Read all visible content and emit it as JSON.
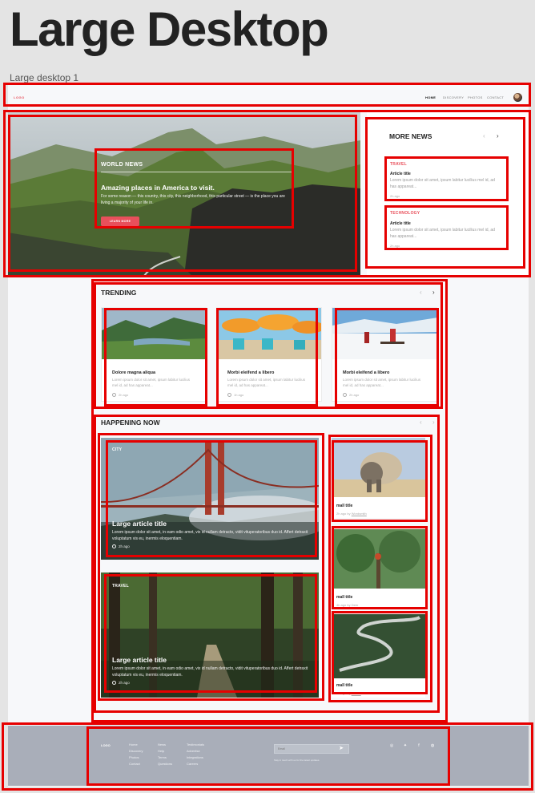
{
  "page": {
    "heading": "Large Desktop",
    "frame_label": "Large desktop 1"
  },
  "colors": {
    "accent": "#e8505b",
    "annotation_box": "#e60000",
    "footer_bg": "#a9aeb9",
    "canvas": "#f7f8fa"
  },
  "nav": {
    "logo": "LOGO",
    "links": [
      "HOME",
      "DISCOVERY",
      "PHOTOS",
      "CONTACT"
    ],
    "active": "HOME",
    "avatar_icon": "user-avatar"
  },
  "hero": {
    "eyebrow": "WORLD NEWS",
    "title": "Amazing places in America to visit.",
    "text": "For some reason — this country, this city, this neighborhood, this particular street — is the place you are living a majority of your life in.",
    "button": "LEARN MORE"
  },
  "more_news": {
    "title": "MORE NEWS",
    "prev_icon": "chevron-left-icon",
    "next_icon": "chevron-right-icon",
    "items": [
      {
        "category": "TRAVEL",
        "title": "Article title",
        "text": "Lorem ipsum dolor sit amet, ipsum labitur lucilius mel id, ad has appareat...",
        "meta": "2h ago"
      },
      {
        "category": "TECHNOLOGY",
        "title": "Article title",
        "text": "Lorem ipsum dolor sit amet, ipsum labitur lucilius mel id, ad has appareat...",
        "meta": "2h ago"
      }
    ]
  },
  "trending": {
    "title": "TRENDING",
    "cards": [
      {
        "title": "Dolore magna aliqua",
        "text": "Lorem ipsum dolor sit amet, ipsum labitur lucilius mel id, ad has appareat...",
        "meta": "2h ago"
      },
      {
        "title": "Morbi eleifend a libero",
        "text": "Lorem ipsum dolor sit amet, ipsum labitur lucilius mel id, ad has appareat...",
        "meta": "1h ago"
      },
      {
        "title": "Morbi eleifend a libero",
        "text": "Lorem ipsum dolor sit amet, ipsum labitur lucilius mel id, ad has appareat...",
        "meta": "2h ago"
      }
    ]
  },
  "happening": {
    "title": "HAPPENING NOW",
    "large": [
      {
        "category": "CITY",
        "title": "Large article title",
        "text": "Lorem ipsum dolor sit amet, in eam odio amet, vix id nullam detracto, vidit vituperatoribus duo id. Affert detraxit voluptatum vis eu, inermis eloquentiam.",
        "meta": "2h ago"
      },
      {
        "category": "TRAVEL",
        "title": "Large article title",
        "text": "Lorem ipsum dolor sit amet, in eam odio amet, vix id nullam detracto, vidit vituperatoribus duo id. Affert detraxit voluptatum vis eu, inermis eloquentiam.",
        "meta": "2h ago"
      }
    ],
    "small": [
      {
        "title": "mall title",
        "meta_prefix": "2h ago by",
        "author": "Wordsmith"
      },
      {
        "title": "mall title",
        "meta_prefix": "4h ago by",
        "author": "Deer"
      },
      {
        "title": "mall title",
        "meta_prefix": "1h ago by",
        "author": "Wicket"
      }
    ]
  },
  "footer": {
    "logo": "LOGO",
    "col1": [
      "Home",
      "Discovery",
      "Photos",
      "Contact"
    ],
    "col2": [
      "News",
      "Help",
      "Terms",
      "Questions"
    ],
    "col3": [
      "Testimonials",
      "Advertise",
      "Integrations",
      "Careers"
    ],
    "email_placeholder": "Email",
    "newsletter_note": "Stay in touch with us for the latest updates.",
    "social_icons": [
      "instagram-icon",
      "twitter-icon",
      "facebook-icon",
      "dribbble-icon"
    ]
  }
}
